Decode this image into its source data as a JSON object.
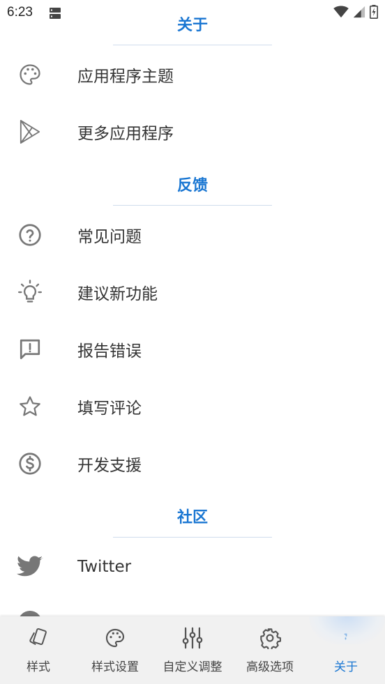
{
  "status_bar": {
    "time": "6:23"
  },
  "sections": [
    {
      "title": "关于",
      "items": [
        {
          "label": "应用程序主题",
          "icon": "palette-icon"
        },
        {
          "label": "更多应用程序",
          "icon": "play-store-icon"
        }
      ]
    },
    {
      "title": "反馈",
      "items": [
        {
          "label": "常见问题",
          "icon": "help-circle-icon"
        },
        {
          "label": "建议新功能",
          "icon": "lightbulb-icon"
        },
        {
          "label": "报告错误",
          "icon": "report-bubble-icon"
        },
        {
          "label": "填写评论",
          "icon": "star-icon"
        },
        {
          "label": "开发支援",
          "icon": "dollar-circle-icon"
        }
      ]
    },
    {
      "title": "社区",
      "items": [
        {
          "label": "Twitter",
          "icon": "twitter-icon"
        }
      ]
    }
  ],
  "bottom_nav": {
    "items": [
      {
        "label": "样式",
        "icon": "cards-icon"
      },
      {
        "label": "样式设置",
        "icon": "palette-icon"
      },
      {
        "label": "自定义调整",
        "icon": "sliders-icon"
      },
      {
        "label": "高级选项",
        "icon": "gear-icon"
      },
      {
        "label": "关于",
        "icon": "info-icon",
        "active": true
      }
    ]
  },
  "colors": {
    "accent": "#1976d2",
    "icon": "#777777",
    "nav_bg": "#f1f1f1"
  }
}
